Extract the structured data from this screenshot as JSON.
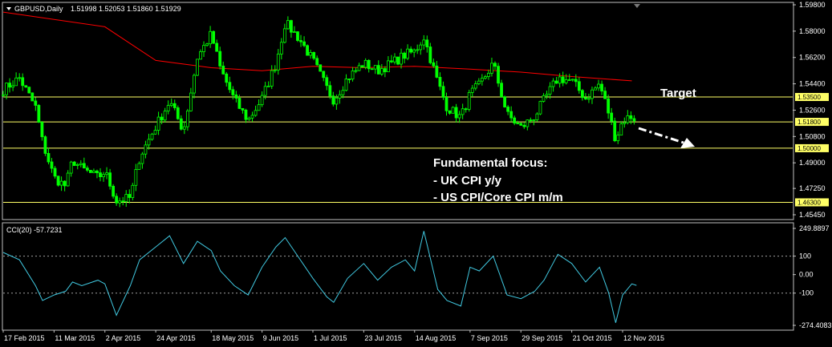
{
  "header": {
    "symbol": "GBPUSD,Daily",
    "ohlc": "1.51998 1.52053 1.51860 1.51929",
    "indicator": "CCI(20) -57.7231"
  },
  "annotations": {
    "target_label": "Target",
    "focus_title": "Fundamental focus:",
    "focus_items": [
      "- UK CPI y/y",
      "- US CPI/Core CPI m/m"
    ]
  },
  "colors": {
    "background": "#000000",
    "candle": "#00ff00",
    "ma": "#ff0000",
    "level": "#ffff66",
    "cci": "#40c8e0",
    "frame": "#c0c0c0",
    "arrow": "#ffffff"
  },
  "chart_data": [
    {
      "type": "candlestick",
      "title": "GBPUSD,Daily",
      "ylim": [
        1.4545,
        1.598
      ],
      "y_ticks": [
        "1.59800",
        "1.58000",
        "1.56200",
        "1.54400",
        "1.52600",
        "1.50800",
        "1.49000",
        "1.47250",
        "1.45450"
      ],
      "x_ticks": [
        "17 Feb 2015",
        "11 Mar 2015",
        "2 Apr 2015",
        "24 Apr 2015",
        "18 May 2015",
        "9 Jun 2015",
        "1 Jul 2015",
        "23 Jul 2015",
        "14 Aug 2015",
        "7 Sep 2015",
        "29 Sep 2015",
        "21 Oct 2015",
        "12 Nov 2015"
      ],
      "levels": [
        {
          "value": 1.535,
          "label": "1.53500"
        },
        {
          "value": 1.518,
          "label": "1.51800"
        },
        {
          "value": 1.5,
          "label": "1.50000"
        },
        {
          "value": 1.463,
          "label": "1.46300"
        }
      ],
      "close_path": [
        {
          "x": "17 Feb 2015",
          "y": 1.54
        },
        {
          "x": "24 Feb 2015",
          "y": 1.548
        },
        {
          "x": "3 Mar 2015",
          "y": 1.528
        },
        {
          "x": "6 Mar 2015",
          "y": 1.504
        },
        {
          "x": "11 Mar 2015",
          "y": 1.48
        },
        {
          "x": "16 Mar 2015",
          "y": 1.474
        },
        {
          "x": "19 Mar 2015",
          "y": 1.492
        },
        {
          "x": "23 Mar 2015",
          "y": 1.486
        },
        {
          "x": "30 Mar 2015",
          "y": 1.48
        },
        {
          "x": "2 Apr 2015",
          "y": 1.484
        },
        {
          "x": "7 Apr 2015",
          "y": 1.464
        },
        {
          "x": "13 Apr 2015",
          "y": 1.466
        },
        {
          "x": "17 Apr 2015",
          "y": 1.494
        },
        {
          "x": "24 Apr 2015",
          "y": 1.515
        },
        {
          "x": "30 Apr 2015",
          "y": 1.532
        },
        {
          "x": "6 May 2015",
          "y": 1.512
        },
        {
          "x": "12 May 2015",
          "y": 1.562
        },
        {
          "x": "18 May 2015",
          "y": 1.578
        },
        {
          "x": "22 May 2015",
          "y": 1.554
        },
        {
          "x": "28 May 2015",
          "y": 1.533
        },
        {
          "x": "3 Jun 2015",
          "y": 1.519
        },
        {
          "x": "9 Jun 2015",
          "y": 1.534
        },
        {
          "x": "15 Jun 2015",
          "y": 1.558
        },
        {
          "x": "19 Jun 2015",
          "y": 1.586
        },
        {
          "x": "25 Jun 2015",
          "y": 1.575
        },
        {
          "x": "1 Jul 2015",
          "y": 1.56
        },
        {
          "x": "7 Jul 2015",
          "y": 1.541
        },
        {
          "x": "10 Jul 2015",
          "y": 1.533
        },
        {
          "x": "16 Jul 2015",
          "y": 1.548
        },
        {
          "x": "23 Jul 2015",
          "y": 1.558
        },
        {
          "x": "29 Jul 2015",
          "y": 1.553
        },
        {
          "x": "4 Aug 2015",
          "y": 1.558
        },
        {
          "x": "10 Aug 2015",
          "y": 1.564
        },
        {
          "x": "14 Aug 2015",
          "y": 1.566
        },
        {
          "x": "18 Aug 2015",
          "y": 1.576
        },
        {
          "x": "24 Aug 2015",
          "y": 1.545
        },
        {
          "x": "28 Aug 2015",
          "y": 1.528
        },
        {
          "x": "3 Sep 2015",
          "y": 1.521
        },
        {
          "x": "7 Sep 2015",
          "y": 1.537
        },
        {
          "x": "11 Sep 2015",
          "y": 1.543
        },
        {
          "x": "17 Sep 2015",
          "y": 1.558
        },
        {
          "x": "23 Sep 2015",
          "y": 1.523
        },
        {
          "x": "29 Sep 2015",
          "y": 1.514
        },
        {
          "x": "5 Oct 2015",
          "y": 1.522
        },
        {
          "x": "9 Oct 2015",
          "y": 1.533
        },
        {
          "x": "15 Oct 2015",
          "y": 1.548
        },
        {
          "x": "21 Oct 2015",
          "y": 1.546
        },
        {
          "x": "27 Oct 2015",
          "y": 1.534
        },
        {
          "x": "2 Nov 2015",
          "y": 1.544
        },
        {
          "x": "6 Nov 2015",
          "y": 1.524
        },
        {
          "x": "9 Nov 2015",
          "y": 1.506
        },
        {
          "x": "12 Nov 2015",
          "y": 1.519
        },
        {
          "x": "16 Nov 2015",
          "y": 1.522
        },
        {
          "x": "18 Nov 2015",
          "y": 1.519
        }
      ],
      "ma_path": [
        {
          "x": "17 Feb 2015",
          "y": 1.593
        },
        {
          "x": "2 Apr 2015",
          "y": 1.583
        },
        {
          "x": "24 Apr 2015",
          "y": 1.56
        },
        {
          "x": "18 May 2015",
          "y": 1.555
        },
        {
          "x": "9 Jun 2015",
          "y": 1.553
        },
        {
          "x": "1 Jul 2015",
          "y": 1.556
        },
        {
          "x": "23 Jul 2015",
          "y": 1.555
        },
        {
          "x": "14 Aug 2015",
          "y": 1.556
        },
        {
          "x": "7 Sep 2015",
          "y": 1.554
        },
        {
          "x": "29 Sep 2015",
          "y": 1.552
        },
        {
          "x": "21 Oct 2015",
          "y": 1.549
        },
        {
          "x": "16 Nov 2015",
          "y": 1.546
        }
      ]
    },
    {
      "type": "line",
      "title": "CCI(20) -57.7231",
      "ylim": [
        -274.4083,
        249.8897
      ],
      "y_ticks": [
        "249.8897",
        "100",
        "0.00",
        "-100",
        "-274.4083"
      ],
      "reference_levels": [
        100,
        -100
      ],
      "series": [
        {
          "name": "CCI(20)",
          "points": [
            {
              "x": "17 Feb 2015",
              "y": 120
            },
            {
              "x": "24 Feb 2015",
              "y": 80
            },
            {
              "x": "3 Mar 2015",
              "y": -60
            },
            {
              "x": "6 Mar 2015",
              "y": -140
            },
            {
              "x": "11 Mar 2015",
              "y": -110
            },
            {
              "x": "16 Mar 2015",
              "y": -90
            },
            {
              "x": "19 Mar 2015",
              "y": -40
            },
            {
              "x": "23 Mar 2015",
              "y": -60
            },
            {
              "x": "30 Mar 2015",
              "y": -30
            },
            {
              "x": "2 Apr 2015",
              "y": -50
            },
            {
              "x": "7 Apr 2015",
              "y": -220
            },
            {
              "x": "13 Apr 2015",
              "y": -60
            },
            {
              "x": "17 Apr 2015",
              "y": 80
            },
            {
              "x": "24 Apr 2015",
              "y": 150
            },
            {
              "x": "30 Apr 2015",
              "y": 210
            },
            {
              "x": "6 May 2015",
              "y": 60
            },
            {
              "x": "12 May 2015",
              "y": 180
            },
            {
              "x": "18 May 2015",
              "y": 130
            },
            {
              "x": "22 May 2015",
              "y": 20
            },
            {
              "x": "28 May 2015",
              "y": -60
            },
            {
              "x": "3 Jun 2015",
              "y": -110
            },
            {
              "x": "9 Jun 2015",
              "y": 40
            },
            {
              "x": "15 Jun 2015",
              "y": 150
            },
            {
              "x": "19 Jun 2015",
              "y": 200
            },
            {
              "x": "25 Jun 2015",
              "y": 90
            },
            {
              "x": "1 Jul 2015",
              "y": -20
            },
            {
              "x": "7 Jul 2015",
              "y": -120
            },
            {
              "x": "10 Jul 2015",
              "y": -150
            },
            {
              "x": "16 Jul 2015",
              "y": -20
            },
            {
              "x": "23 Jul 2015",
              "y": 60
            },
            {
              "x": "29 Jul 2015",
              "y": -30
            },
            {
              "x": "4 Aug 2015",
              "y": 40
            },
            {
              "x": "10 Aug 2015",
              "y": 80
            },
            {
              "x": "14 Aug 2015",
              "y": 20
            },
            {
              "x": "18 Aug 2015",
              "y": 235
            },
            {
              "x": "24 Aug 2015",
              "y": -80
            },
            {
              "x": "28 Aug 2015",
              "y": -140
            },
            {
              "x": "3 Sep 2015",
              "y": -170
            },
            {
              "x": "7 Sep 2015",
              "y": 40
            },
            {
              "x": "11 Sep 2015",
              "y": 20
            },
            {
              "x": "17 Sep 2015",
              "y": 100
            },
            {
              "x": "23 Sep 2015",
              "y": -110
            },
            {
              "x": "29 Sep 2015",
              "y": -130
            },
            {
              "x": "5 Oct 2015",
              "y": -90
            },
            {
              "x": "9 Oct 2015",
              "y": -30
            },
            {
              "x": "15 Oct 2015",
              "y": 110
            },
            {
              "x": "21 Oct 2015",
              "y": 60
            },
            {
              "x": "27 Oct 2015",
              "y": -40
            },
            {
              "x": "2 Nov 2015",
              "y": 40
            },
            {
              "x": "6 Nov 2015",
              "y": -100
            },
            {
              "x": "9 Nov 2015",
              "y": -260
            },
            {
              "x": "12 Nov 2015",
              "y": -110
            },
            {
              "x": "16 Nov 2015",
              "y": -50
            },
            {
              "x": "18 Nov 2015",
              "y": -58
            }
          ]
        }
      ]
    }
  ]
}
